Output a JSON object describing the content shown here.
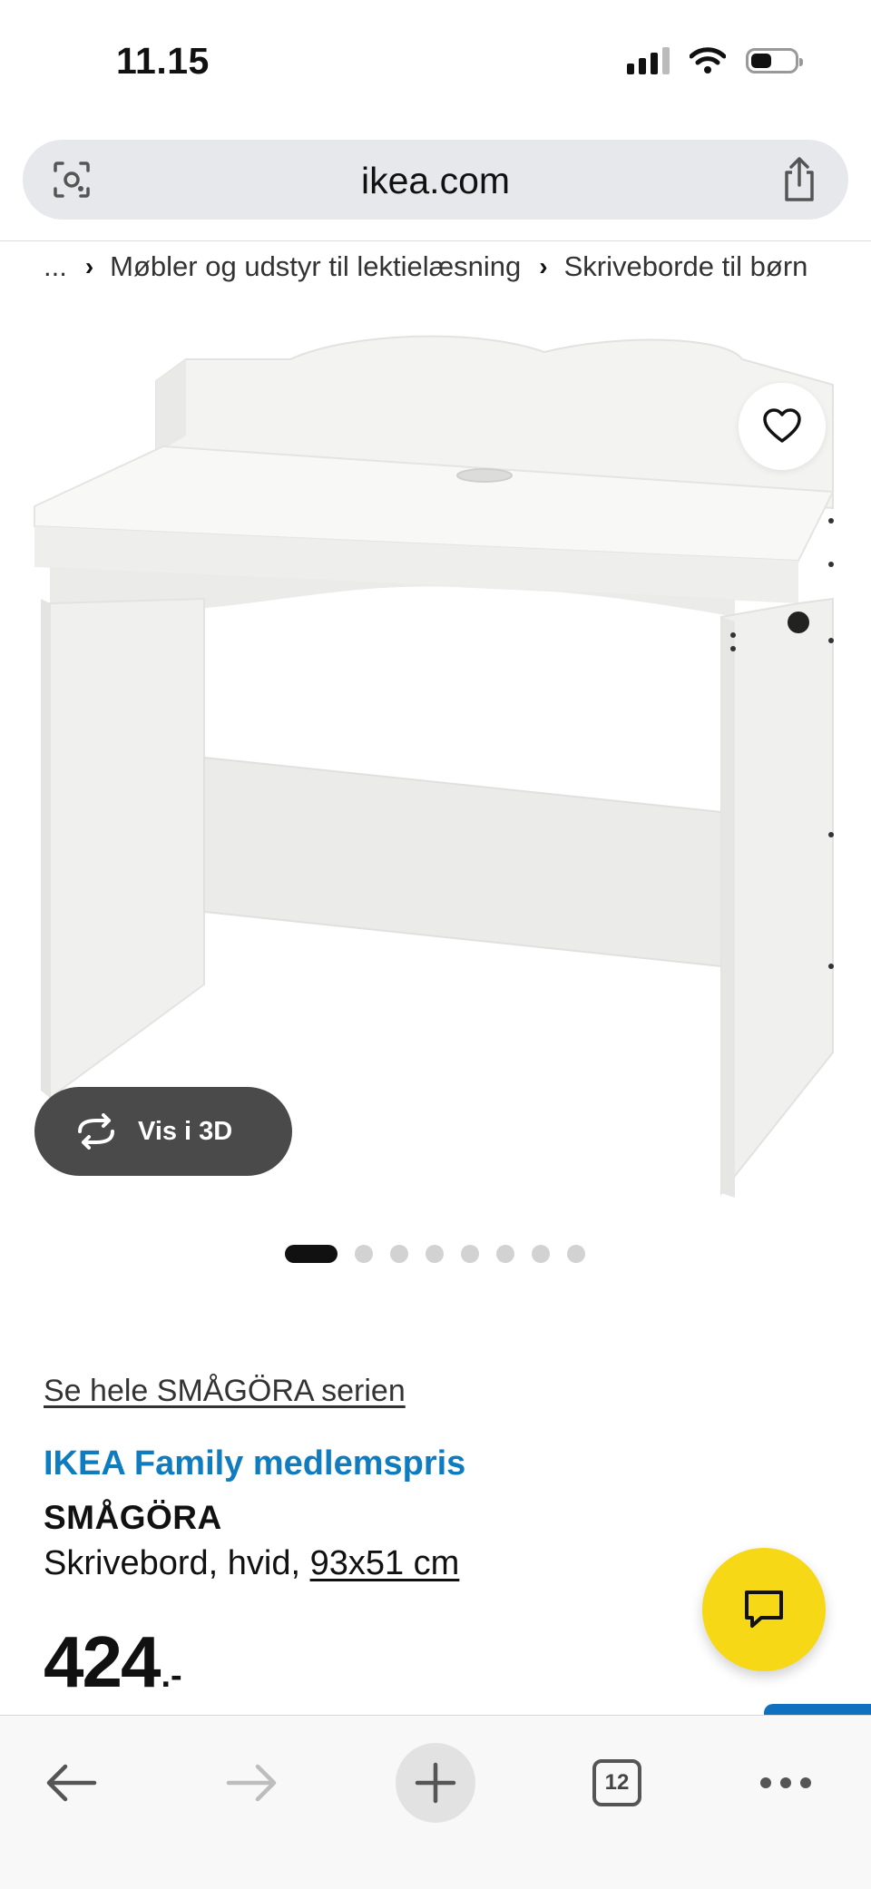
{
  "status_bar": {
    "time": "11.15"
  },
  "browser": {
    "url": "ikea.com",
    "tab_count": "12"
  },
  "breadcrumb": {
    "ellipsis": "...",
    "items": [
      "Møbler og udstyr til lektielæsning",
      "Skriveborde til børn"
    ]
  },
  "gallery": {
    "view_3d_label": "Vis i 3D",
    "image_count": 8,
    "active_index": 0
  },
  "product": {
    "series_link": "Se hele SMÅGÖRA serien",
    "family_label": "IKEA Family medlemspris",
    "name": "SMÅGÖRA",
    "description": "Skrivebord, hvid,",
    "size": "93x51 cm",
    "price": "424",
    "price_suffix": ".-"
  },
  "colors": {
    "family_blue": "#0f7cbf",
    "chat_yellow": "#f6d816",
    "button_dark": "#4a4a4a"
  },
  "icons": [
    "signal-icon",
    "wifi-icon",
    "battery-icon",
    "visual-search-icon",
    "share-icon",
    "heart-icon",
    "rotate-3d-icon",
    "chat-icon",
    "back-icon",
    "forward-icon",
    "plus-icon",
    "tabs-icon",
    "more-icon"
  ]
}
